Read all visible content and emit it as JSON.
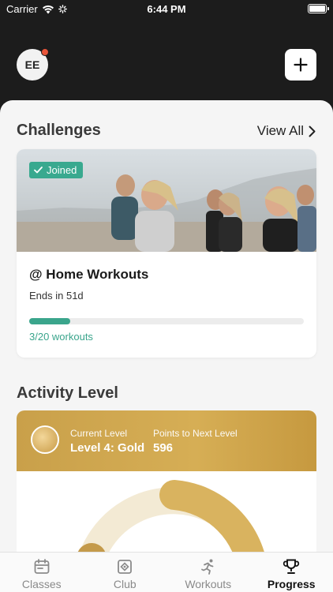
{
  "status": {
    "carrier": "Carrier",
    "time": "6:44 PM"
  },
  "header": {
    "avatar_initials": "EE"
  },
  "challenges": {
    "title": "Challenges",
    "view_all": "View All",
    "card": {
      "badge": "Joined",
      "name": "@ Home Workouts",
      "ends": "Ends in 51d",
      "progress": 0.15,
      "progress_label": "3/20 workouts"
    }
  },
  "activity": {
    "title": "Activity Level",
    "current_level_label": "Current Level",
    "current_level": "Level 4: Gold",
    "points_label": "Points to Next Level",
    "points": "596"
  },
  "tabs": [
    {
      "label": "Classes",
      "icon": "calendar-icon"
    },
    {
      "label": "Club",
      "icon": "club-icon"
    },
    {
      "label": "Workouts",
      "icon": "runner-icon"
    },
    {
      "label": "Progress",
      "icon": "trophy-icon",
      "active": true
    }
  ],
  "colors": {
    "accent": "#3aa58c",
    "gold": "#c9a04a",
    "badge": "#39a98f",
    "notification": "#e8553a"
  }
}
